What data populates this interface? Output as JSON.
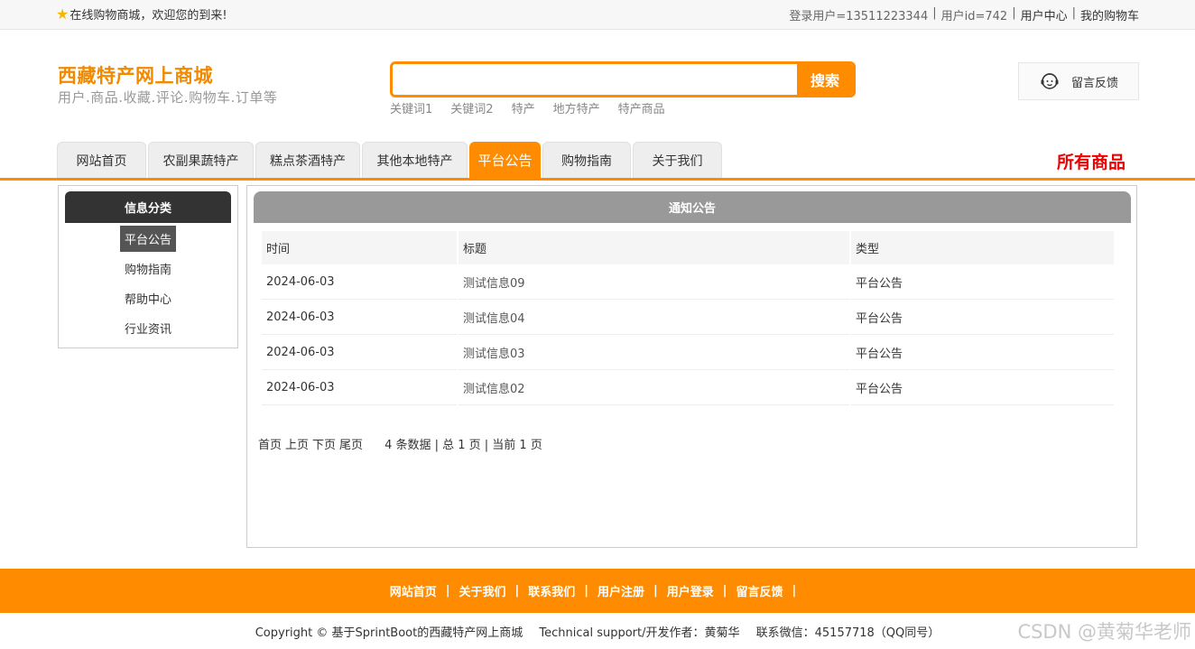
{
  "topbar": {
    "welcome": "在线购物商城，欢迎您的到来!",
    "user_login": "登录用户=13511223344",
    "user_id": "用户id=742",
    "user_center": "用户中心",
    "cart": "我的购物车",
    "separator": "|"
  },
  "header": {
    "title": "西藏特产网上商城",
    "subtitle": "用户.商品.收藏.评论.购物车.订单等",
    "search_value": "",
    "search_button": "搜索",
    "keywords": [
      "关键词1",
      "关键词2",
      "特产",
      "地方特产",
      "特产商品"
    ],
    "feedback": "留言反馈"
  },
  "nav": {
    "tabs": [
      {
        "label": "网站首页"
      },
      {
        "label": "农副果蔬特产"
      },
      {
        "label": "糕点茶酒特产"
      },
      {
        "label": "其他本地特产"
      },
      {
        "label": "平台公告"
      },
      {
        "label": "购物指南"
      },
      {
        "label": "关于我们"
      }
    ],
    "all_goods": "所有商品"
  },
  "sidebar": {
    "title": "信息分类",
    "items": [
      {
        "label": "平台公告"
      },
      {
        "label": "购物指南"
      },
      {
        "label": "帮助中心"
      },
      {
        "label": "行业资讯"
      }
    ]
  },
  "main": {
    "title": "通知公告",
    "columns": [
      "时间",
      "标题",
      "类型"
    ],
    "rows": [
      {
        "time": "2024-06-03",
        "title": "测试信息09",
        "type": "平台公告"
      },
      {
        "time": "2024-06-03",
        "title": "测试信息04",
        "type": "平台公告"
      },
      {
        "time": "2024-06-03",
        "title": "测试信息03",
        "type": "平台公告"
      },
      {
        "time": "2024-06-03",
        "title": "测试信息02",
        "type": "平台公告"
      }
    ],
    "pager": {
      "first": "首页",
      "prev": "上页",
      "next": "下页",
      "last": "尾页",
      "info": "4 条数据 | 总 1 页 | 当前 1 页"
    }
  },
  "footer": {
    "links": [
      "网站首页",
      "关于我们",
      "联系我们",
      "用户注册",
      "用户登录",
      "留言反馈"
    ],
    "separator": "|",
    "copyright": "Copyright © 基于SprintBoot的西藏特产网上商城",
    "support": "Technical support/开发作者：黄菊华",
    "contact": "联系微信：45157718（QQ同号）",
    "watermark": "CSDN @黄菊华老师"
  },
  "colors": {
    "accent": "#ff8c00",
    "title": "#f08a00",
    "all_goods": "#ee0000",
    "sidebar_head": "#333333",
    "main_head": "#999999"
  }
}
